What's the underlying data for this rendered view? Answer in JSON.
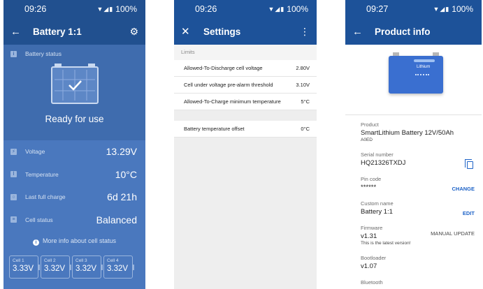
{
  "screens": [
    {
      "status": {
        "time": "09:26",
        "battery": "100%"
      },
      "appbar": {
        "title": "Battery 1:1"
      },
      "battery_status": {
        "label": "Battery status",
        "state": "Ready for use"
      },
      "metrics": [
        {
          "label": "Voltage",
          "value": "13.29V",
          "icon": "voltage-icon"
        },
        {
          "label": "Temperature",
          "value": "10°C",
          "icon": "thermometer-icon"
        },
        {
          "label": "Last full charge",
          "value": "6d 21h",
          "icon": "clock-icon"
        },
        {
          "label": "Cell status",
          "value": "Balanced",
          "icon": "list-icon"
        }
      ],
      "more_info": "More info about cell status",
      "cells": [
        {
          "name": "Cell 1",
          "value": "3.33V"
        },
        {
          "name": "Cell 2",
          "value": "3.32V"
        },
        {
          "name": "Cell 3",
          "value": "3.32V"
        },
        {
          "name": "Cell 4",
          "value": "3.32V"
        }
      ],
      "colors": {
        "background": "#4a78be",
        "appbar": "#21508f"
      }
    },
    {
      "status": {
        "time": "09:26",
        "battery": "100%"
      },
      "appbar": {
        "title": "Settings"
      },
      "limits_label": "Limits",
      "limits": [
        {
          "label": "Allowed-To-Discharge cell voltage",
          "value": "2.80V"
        },
        {
          "label": "Cell under voltage pre-alarm threshold",
          "value": "3.10V"
        },
        {
          "label": "Allowed-To-Charge minimum temperature",
          "value": "5°C"
        }
      ],
      "extra": [
        {
          "label": "Battery temperature offset",
          "value": "0°C"
        }
      ],
      "colors": {
        "appbar": "#1d5299"
      }
    },
    {
      "status": {
        "time": "09:27",
        "battery": "100%"
      },
      "appbar": {
        "title": "Product info"
      },
      "product_image": {
        "label": "Lithium"
      },
      "info": {
        "product": {
          "label": "Product",
          "value": "SmartLithium Battery 12V/50Ah",
          "sub": "A0ED"
        },
        "serial": {
          "label": "Serial number",
          "value": "HQ21326TXDJ"
        },
        "pin": {
          "label": "Pin code",
          "value": "******",
          "action": "CHANGE"
        },
        "custom_name": {
          "label": "Custom name",
          "value": "Battery 1:1",
          "action": "EDIT"
        },
        "firmware": {
          "label": "Firmware",
          "value": "v1.31",
          "note": "This is the latest version!",
          "action": "MANUAL UPDATE"
        },
        "bootloader": {
          "label": "Bootloader",
          "value": "v1.07"
        },
        "bluetooth": {
          "label": "Bluetooth"
        }
      },
      "colors": {
        "appbar": "#1d5299",
        "accent": "#1e63c7"
      }
    }
  ]
}
